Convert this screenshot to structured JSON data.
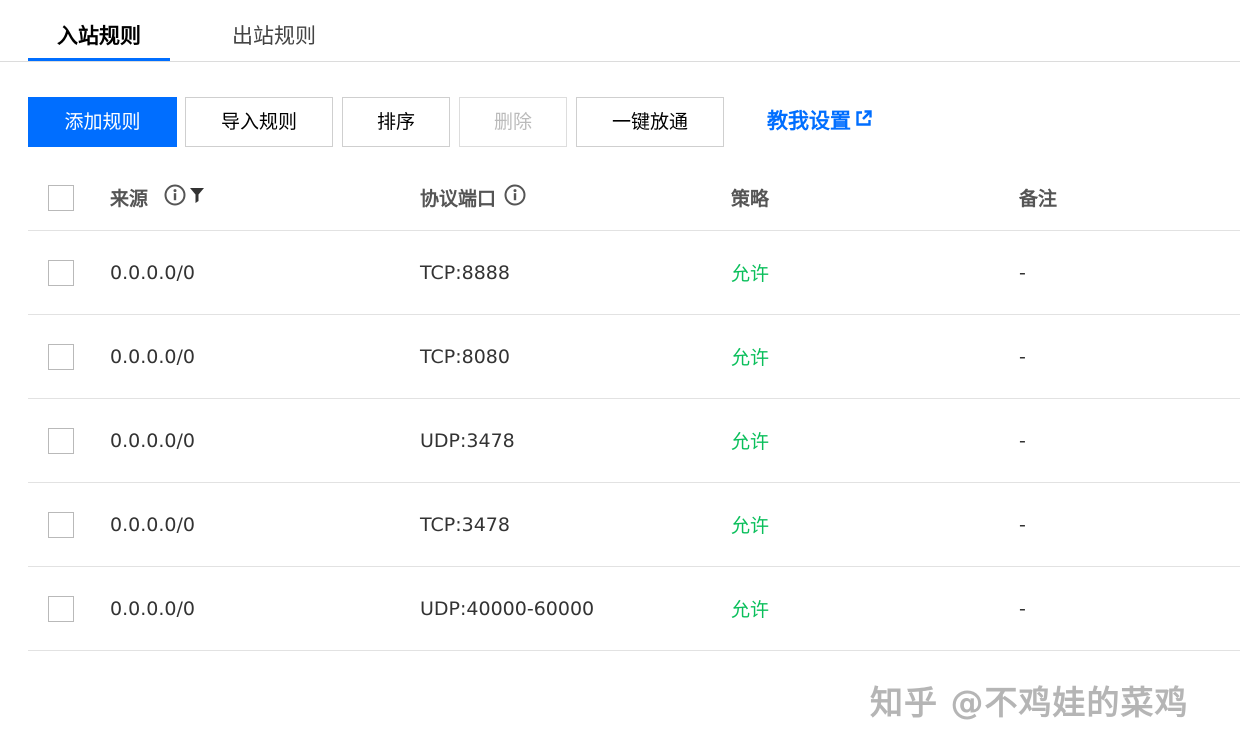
{
  "tabs": [
    {
      "label": "入站规则",
      "active": true
    },
    {
      "label": "出站规则",
      "active": false
    }
  ],
  "toolbar": {
    "add_label": "添加规则",
    "import_label": "导入规则",
    "sort_label": "排序",
    "delete_label": "删除",
    "open_all_label": "一键放通",
    "help_label": "教我设置"
  },
  "table": {
    "headers": {
      "source": "来源",
      "protocol_port": "协议端口",
      "policy": "策略",
      "note": "备注"
    },
    "rows": [
      {
        "source": "0.0.0.0/0",
        "protocol_port": "TCP:8888",
        "policy": "允许",
        "note": "-"
      },
      {
        "source": "0.0.0.0/0",
        "protocol_port": "TCP:8080",
        "policy": "允许",
        "note": "-"
      },
      {
        "source": "0.0.0.0/0",
        "protocol_port": "UDP:3478",
        "policy": "允许",
        "note": "-"
      },
      {
        "source": "0.0.0.0/0",
        "protocol_port": "TCP:3478",
        "policy": "允许",
        "note": "-"
      },
      {
        "source": "0.0.0.0/0",
        "protocol_port": "UDP:40000-60000",
        "policy": "允许",
        "note": "-"
      }
    ]
  },
  "watermark": "知乎 @不鸡娃的菜鸡",
  "colors": {
    "primary": "#006eff",
    "allow": "#0abf5b",
    "border": "#e2e2e2"
  },
  "icons": {
    "external_link": "external-link-icon",
    "info": "info-icon",
    "filter": "filter-icon"
  }
}
